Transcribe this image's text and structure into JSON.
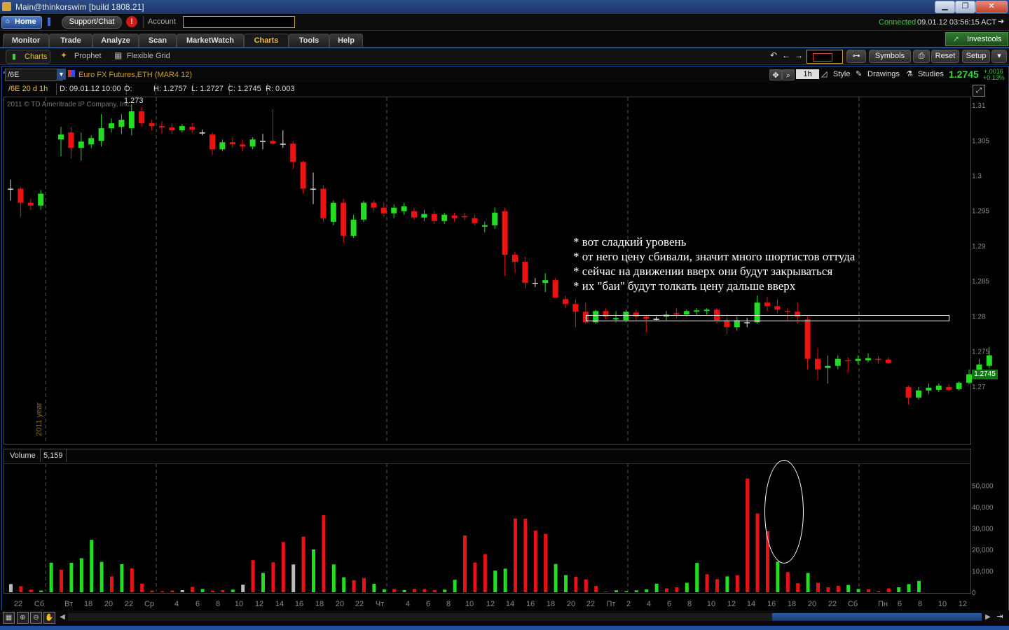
{
  "window": {
    "title": "Main@thinkorswim [build 1808.21]",
    "minimize": "▁",
    "maximize": "❐",
    "close": "✕"
  },
  "topbar": {
    "home": "Home",
    "support": "Support/Chat",
    "alert": "!",
    "account_label": "Account",
    "account_value": "",
    "status_connected": "Connected",
    "status_time": "09.01.12 03:56:15 ACT"
  },
  "tabs": [
    "Monitor",
    "Trade",
    "Analyze",
    "Scan",
    "MarketWatch",
    "Charts",
    "Tools",
    "Help"
  ],
  "investools": "Investools",
  "subtabs": {
    "charts": "Charts",
    "prophet": "Prophet",
    "flexible_grid": "Flexible Grid"
  },
  "toolbar_right": {
    "symbols": "Symbols",
    "reset": "Reset",
    "setup": "Setup"
  },
  "chart_header": {
    "symbol": "/6E",
    "description": "Euro FX Futures,ETH (MAR4 12)",
    "aggregation": "1h",
    "style": "Style",
    "drawings": "Drawings",
    "studies": "Studies",
    "last_price": "1.2745",
    "change_abs": "+.0016",
    "change_pct": "+0.13%"
  },
  "info_bar": {
    "period": "/6E 20 d 1h",
    "date": "D: 09.01.12 10:00",
    "open": "O: 1.273",
    "high": "H: 1.2757",
    "low": "L: 1.2727",
    "close": "C: 1.2745",
    "range": "R: 0.003"
  },
  "copyright": "2011 © TD Ameritrade IP Company, Inc.",
  "year_label": "2011 year",
  "price_label": "1.2745",
  "annotation": [
    "* вот сладкий уровень",
    "* от него цену сбивали, значит много шортистов оттуда",
    "* сейчас на движении вверх они будут закрываться",
    "* их \"баи\" будут толкать цену дальше вверх"
  ],
  "volume": {
    "label": "Volume",
    "value": "5,159"
  },
  "colors": {
    "up": "#22dd22",
    "down": "#ee1111",
    "neutral": "#dddddd",
    "grid": "#555555",
    "accent": "#f0c040"
  },
  "chart_data": [
    {
      "type": "candlestick",
      "y_ticks": [
        "1.31",
        "1.305",
        "1.3",
        "1.295",
        "1.29",
        "1.285",
        "1.28",
        "1.275",
        "1.27"
      ],
      "ylim": [
        1.2663,
        1.3108
      ],
      "candles": [
        {
          "o": 1.2982,
          "h": 1.2995,
          "l": 1.2965,
          "c": 1.2982
        },
        {
          "o": 1.2982,
          "h": 1.2985,
          "l": 1.2942,
          "c": 1.2962
        },
        {
          "o": 1.2962,
          "h": 1.2968,
          "l": 1.2952,
          "c": 1.2958
        },
        {
          "o": 1.2958,
          "h": 1.298,
          "l": 1.2952,
          "c": 1.2975
        },
        null,
        {
          "o": 1.3052,
          "h": 1.307,
          "l": 1.3028,
          "c": 1.3059
        },
        {
          "o": 1.3062,
          "h": 1.307,
          "l": 1.3025,
          "c": 1.304
        },
        {
          "o": 1.304,
          "h": 1.3062,
          "l": 1.3022,
          "c": 1.3049
        },
        {
          "o": 1.3045,
          "h": 1.3058,
          "l": 1.304,
          "c": 1.3054
        },
        {
          "o": 1.305,
          "h": 1.3088,
          "l": 1.3042,
          "c": 1.3068
        },
        {
          "o": 1.3068,
          "h": 1.3082,
          "l": 1.3062,
          "c": 1.3075
        },
        {
          "o": 1.307,
          "h": 1.3088,
          "l": 1.306,
          "c": 1.308
        },
        {
          "o": 1.3068,
          "h": 1.3102,
          "l": 1.3058,
          "c": 1.3092
        },
        {
          "o": 1.3092,
          "h": 1.3098,
          "l": 1.307,
          "c": 1.3075
        },
        {
          "o": 1.3075,
          "h": 1.308,
          "l": 1.3065,
          "c": 1.3071
        },
        {
          "o": 1.3071,
          "h": 1.3078,
          "l": 1.306,
          "c": 1.3069
        },
        {
          "o": 1.3069,
          "h": 1.3075,
          "l": 1.306,
          "c": 1.3065
        },
        {
          "o": 1.3065,
          "h": 1.3074,
          "l": 1.3062,
          "c": 1.3071
        },
        {
          "o": 1.307,
          "h": 1.3075,
          "l": 1.3061,
          "c": 1.3066
        },
        {
          "o": 1.3062,
          "h": 1.3066,
          "l": 1.3058,
          "c": 1.3062
        },
        {
          "o": 1.3059,
          "h": 1.3062,
          "l": 1.303,
          "c": 1.3038
        },
        {
          "o": 1.3038,
          "h": 1.3052,
          "l": 1.3035,
          "c": 1.3048
        },
        {
          "o": 1.3048,
          "h": 1.3055,
          "l": 1.304,
          "c": 1.3045
        },
        {
          "o": 1.3045,
          "h": 1.3052,
          "l": 1.3035,
          "c": 1.3042
        },
        {
          "o": 1.3042,
          "h": 1.3055,
          "l": 1.3038,
          "c": 1.3052
        },
        {
          "o": 1.305,
          "h": 1.306,
          "l": 1.3038,
          "c": 1.305
        },
        {
          "o": 1.305,
          "h": 1.3095,
          "l": 1.3045,
          "c": 1.3046
        },
        {
          "o": 1.3046,
          "h": 1.3065,
          "l": 1.304,
          "c": 1.3046
        },
        {
          "o": 1.3046,
          "h": 1.305,
          "l": 1.301,
          "c": 1.302
        },
        {
          "o": 1.302,
          "h": 1.3022,
          "l": 1.2975,
          "c": 1.2982
        },
        {
          "o": 1.2982,
          "h": 1.3005,
          "l": 1.296,
          "c": 1.2982
        },
        {
          "o": 1.2982,
          "h": 1.2987,
          "l": 1.2935,
          "c": 1.294
        },
        {
          "o": 1.2935,
          "h": 1.2965,
          "l": 1.293,
          "c": 1.2962
        },
        {
          "o": 1.2962,
          "h": 1.2968,
          "l": 1.2905,
          "c": 1.2915
        },
        {
          "o": 1.2915,
          "h": 1.2945,
          "l": 1.2912,
          "c": 1.2938
        },
        {
          "o": 1.2938,
          "h": 1.2965,
          "l": 1.2935,
          "c": 1.2962
        },
        {
          "o": 1.2962,
          "h": 1.2965,
          "l": 1.295,
          "c": 1.2955
        },
        {
          "o": 1.2955,
          "h": 1.2962,
          "l": 1.2942,
          "c": 1.2947
        },
        {
          "o": 1.2947,
          "h": 1.296,
          "l": 1.294,
          "c": 1.2955
        },
        {
          "o": 1.295,
          "h": 1.2962,
          "l": 1.2945,
          "c": 1.2957
        },
        {
          "o": 1.295,
          "h": 1.2955,
          "l": 1.2938,
          "c": 1.2941
        },
        {
          "o": 1.2941,
          "h": 1.2952,
          "l": 1.2936,
          "c": 1.2946
        },
        {
          "o": 1.2946,
          "h": 1.295,
          "l": 1.2932,
          "c": 1.2936
        },
        {
          "o": 1.2936,
          "h": 1.2948,
          "l": 1.2932,
          "c": 1.2945
        },
        {
          "o": 1.2944,
          "h": 1.2948,
          "l": 1.2935,
          "c": 1.294
        },
        {
          "o": 1.2943,
          "h": 1.2948,
          "l": 1.2937,
          "c": 1.2942
        },
        {
          "o": 1.294,
          "h": 1.2945,
          "l": 1.293,
          "c": 1.2933
        },
        {
          "o": 1.2928,
          "h": 1.2935,
          "l": 1.292,
          "c": 1.293
        },
        {
          "o": 1.293,
          "h": 1.2955,
          "l": 1.2925,
          "c": 1.2948
        },
        {
          "o": 1.295,
          "h": 1.2955,
          "l": 1.2858,
          "c": 1.2888
        },
        {
          "o": 1.2888,
          "h": 1.2892,
          "l": 1.2862,
          "c": 1.2878
        },
        {
          "o": 1.2878,
          "h": 1.2885,
          "l": 1.284,
          "c": 1.2848
        },
        {
          "o": 1.2848,
          "h": 1.2855,
          "l": 1.2842,
          "c": 1.2848
        },
        {
          "o": 1.2848,
          "h": 1.2862,
          "l": 1.2835,
          "c": 1.2852
        },
        {
          "o": 1.2852,
          "h": 1.2855,
          "l": 1.283,
          "c": 1.2827
        },
        {
          "o": 1.2825,
          "h": 1.283,
          "l": 1.2812,
          "c": 1.2818
        },
        {
          "o": 1.2818,
          "h": 1.2825,
          "l": 1.2785,
          "c": 1.2807
        },
        {
          "o": 1.2807,
          "h": 1.282,
          "l": 1.279,
          "c": 1.2792
        },
        {
          "o": 1.2792,
          "h": 1.281,
          "l": 1.279,
          "c": 1.2808
        },
        {
          "o": 1.2808,
          "h": 1.2812,
          "l": 1.2796,
          "c": 1.28
        },
        {
          "o": 1.2796,
          "h": 1.2808,
          "l": 1.2792,
          "c": 1.2798
        },
        {
          "o": 1.2795,
          "h": 1.281,
          "l": 1.2792,
          "c": 1.2807
        },
        {
          "o": 1.2806,
          "h": 1.281,
          "l": 1.2795,
          "c": 1.28
        },
        {
          "o": 1.28,
          "h": 1.2803,
          "l": 1.2778,
          "c": 1.2797
        },
        {
          "o": 1.2797,
          "h": 1.28,
          "l": 1.2795,
          "c": 1.2797
        },
        {
          "o": 1.28,
          "h": 1.2808,
          "l": 1.2795,
          "c": 1.2803
        },
        {
          "o": 1.2805,
          "h": 1.2812,
          "l": 1.2798,
          "c": 1.2803
        },
        {
          "o": 1.2803,
          "h": 1.281,
          "l": 1.28,
          "c": 1.2808
        },
        {
          "o": 1.2807,
          "h": 1.2812,
          "l": 1.2802,
          "c": 1.2809
        },
        {
          "o": 1.2808,
          "h": 1.2812,
          "l": 1.2803,
          "c": 1.281
        },
        {
          "o": 1.281,
          "h": 1.2812,
          "l": 1.279,
          "c": 1.2795
        },
        {
          "o": 1.2795,
          "h": 1.28,
          "l": 1.2775,
          "c": 1.2785
        },
        {
          "o": 1.2785,
          "h": 1.28,
          "l": 1.278,
          "c": 1.2795
        },
        {
          "o": 1.2792,
          "h": 1.2798,
          "l": 1.2785,
          "c": 1.2792
        },
        {
          "o": 1.2792,
          "h": 1.283,
          "l": 1.279,
          "c": 1.282
        },
        {
          "o": 1.282,
          "h": 1.2828,
          "l": 1.2808,
          "c": 1.2815
        },
        {
          "o": 1.2815,
          "h": 1.2825,
          "l": 1.2805,
          "c": 1.281
        },
        {
          "o": 1.2808,
          "h": 1.2812,
          "l": 1.2795,
          "c": 1.2807
        },
        {
          "o": 1.2807,
          "h": 1.282,
          "l": 1.279,
          "c": 1.28
        },
        {
          "o": 1.2796,
          "h": 1.28,
          "l": 1.2725,
          "c": 1.274
        },
        {
          "o": 1.274,
          "h": 1.2755,
          "l": 1.271,
          "c": 1.2725
        },
        {
          "o": 1.2727,
          "h": 1.2745,
          "l": 1.2705,
          "c": 1.273
        },
        {
          "o": 1.273,
          "h": 1.2745,
          "l": 1.2725,
          "c": 1.274
        },
        {
          "o": 1.2738,
          "h": 1.2742,
          "l": 1.272,
          "c": 1.2737
        },
        {
          "o": 1.2737,
          "h": 1.2745,
          "l": 1.2732,
          "c": 1.274
        },
        {
          "o": 1.2738,
          "h": 1.2748,
          "l": 1.2735,
          "c": 1.2741
        },
        {
          "o": 1.274,
          "h": 1.2744,
          "l": 1.2733,
          "c": 1.2739
        },
        {
          "o": 1.2739,
          "h": 1.2742,
          "l": 1.2733,
          "c": 1.2734
        },
        null,
        {
          "o": 1.27,
          "h": 1.2702,
          "l": 1.2675,
          "c": 1.2685
        },
        {
          "o": 1.2685,
          "h": 1.27,
          "l": 1.2682,
          "c": 1.2695
        },
        {
          "o": 1.2695,
          "h": 1.2705,
          "l": 1.269,
          "c": 1.2699
        },
        {
          "o": 1.2696,
          "h": 1.2705,
          "l": 1.2693,
          "c": 1.2702
        },
        {
          "o": 1.27,
          "h": 1.2704,
          "l": 1.2695,
          "c": 1.2696
        },
        {
          "o": 1.2697,
          "h": 1.2708,
          "l": 1.2695,
          "c": 1.2706
        },
        {
          "o": 1.2706,
          "h": 1.2725,
          "l": 1.2704,
          "c": 1.2718
        },
        {
          "o": 1.2718,
          "h": 1.274,
          "l": 1.2715,
          "c": 1.2732
        },
        {
          "o": 1.273,
          "h": 1.2757,
          "l": 1.2727,
          "c": 1.2745
        }
      ]
    },
    {
      "type": "bar",
      "ylim": [
        0,
        57000
      ],
      "y_ticks": [
        "50,000",
        "40,000",
        "30,000",
        "20,000",
        "10,000",
        "0"
      ],
      "x_ticks": [
        "22",
        "Сб",
        "Вт",
        "18",
        "20",
        "22",
        "Ср",
        "4",
        "6",
        "8",
        "10",
        "12",
        "14",
        "16",
        "18",
        "20",
        "22",
        "Чт",
        "4",
        "6",
        "8",
        "10",
        "12",
        "14",
        "16",
        "18",
        "20",
        "22",
        "Пт",
        "2",
        "4",
        "6",
        "8",
        "10",
        "12",
        "14",
        "16",
        "18",
        "20",
        "22",
        "Сб",
        "Пн",
        "6",
        "8",
        "10",
        "12"
      ],
      "bars": [
        {
          "v": 3800,
          "c": "n"
        },
        {
          "v": 2800,
          "c": "d"
        },
        {
          "v": 1200,
          "c": "d"
        },
        {
          "v": 800,
          "c": "u"
        },
        {
          "v": 13800,
          "c": "u"
        },
        {
          "v": 10500,
          "c": "d"
        },
        {
          "v": 13800,
          "c": "u"
        },
        {
          "v": 15900,
          "c": "u"
        },
        {
          "v": 24500,
          "c": "u"
        },
        {
          "v": 14200,
          "c": "u"
        },
        {
          "v": 7400,
          "c": "d"
        },
        {
          "v": 13100,
          "c": "u"
        },
        {
          "v": 11100,
          "c": "d"
        },
        {
          "v": 4000,
          "c": "d"
        },
        {
          "v": 800,
          "c": "d"
        },
        {
          "v": 500,
          "c": "d"
        },
        {
          "v": 800,
          "c": "d"
        },
        {
          "v": 1000,
          "c": "n"
        },
        {
          "v": 2500,
          "c": "d"
        },
        {
          "v": 1500,
          "c": "u"
        },
        {
          "v": 800,
          "c": "d"
        },
        {
          "v": 1000,
          "c": "d"
        },
        {
          "v": 1200,
          "c": "u"
        },
        {
          "v": 3500,
          "c": "n"
        },
        {
          "v": 15000,
          "c": "d"
        },
        {
          "v": 9000,
          "c": "u"
        },
        {
          "v": 14000,
          "c": "d"
        },
        {
          "v": 23500,
          "c": "d"
        },
        {
          "v": 13000,
          "c": "n"
        },
        {
          "v": 26000,
          "c": "d"
        },
        {
          "v": 20000,
          "c": "u"
        },
        {
          "v": 36000,
          "c": "d"
        },
        {
          "v": 13000,
          "c": "u"
        },
        {
          "v": 7000,
          "c": "u"
        },
        {
          "v": 5600,
          "c": "d"
        },
        {
          "v": 6600,
          "c": "d"
        },
        {
          "v": 3900,
          "c": "u"
        },
        {
          "v": 1300,
          "c": "u"
        },
        {
          "v": 1500,
          "c": "d"
        },
        {
          "v": 1000,
          "c": "u"
        },
        {
          "v": 1500,
          "c": "d"
        },
        {
          "v": 1500,
          "c": "d"
        },
        {
          "v": 1000,
          "c": "d"
        },
        {
          "v": 1200,
          "c": "u"
        },
        {
          "v": 5800,
          "c": "u"
        },
        {
          "v": 26500,
          "c": "d"
        },
        {
          "v": 13900,
          "c": "d"
        },
        {
          "v": 17800,
          "c": "d"
        },
        {
          "v": 10100,
          "c": "u"
        },
        {
          "v": 11000,
          "c": "u"
        },
        {
          "v": 34500,
          "c": "d"
        },
        {
          "v": 34400,
          "c": "d"
        },
        {
          "v": 28800,
          "c": "d"
        },
        {
          "v": 27300,
          "c": "d"
        },
        {
          "v": 13200,
          "c": "u"
        },
        {
          "v": 8000,
          "c": "u"
        },
        {
          "v": 7200,
          "c": "d"
        },
        {
          "v": 6000,
          "c": "d"
        },
        {
          "v": 2900,
          "c": "d"
        },
        {
          "v": 300,
          "c": "d"
        },
        {
          "v": 900,
          "c": "u"
        },
        {
          "v": 500,
          "c": "u"
        },
        {
          "v": 900,
          "c": "u"
        },
        {
          "v": 1300,
          "c": "u"
        },
        {
          "v": 4000,
          "c": "u"
        },
        {
          "v": 1800,
          "c": "d"
        },
        {
          "v": 2300,
          "c": "d"
        },
        {
          "v": 4400,
          "c": "u"
        },
        {
          "v": 13700,
          "c": "u"
        },
        {
          "v": 8400,
          "c": "d"
        },
        {
          "v": 6100,
          "c": "d"
        },
        {
          "v": 7400,
          "c": "u"
        },
        {
          "v": 7900,
          "c": "d"
        },
        {
          "v": 53200,
          "c": "d"
        },
        {
          "v": 36800,
          "c": "d"
        },
        {
          "v": 28500,
          "c": "d"
        },
        {
          "v": 14300,
          "c": "u"
        },
        {
          "v": 9400,
          "c": "d"
        },
        {
          "v": 4200,
          "c": "d"
        },
        {
          "v": 9000,
          "c": "u"
        },
        {
          "v": 4400,
          "c": "d"
        },
        {
          "v": 2300,
          "c": "d"
        },
        {
          "v": 3000,
          "c": "d"
        },
        {
          "v": 3400,
          "c": "u"
        },
        {
          "v": 1500,
          "c": "u"
        },
        {
          "v": 1300,
          "c": "d"
        },
        {
          "v": 500,
          "c": "d"
        },
        {
          "v": 1800,
          "c": "d"
        },
        {
          "v": 2300,
          "c": "u"
        },
        {
          "v": 3800,
          "c": "u"
        },
        {
          "v": 5300,
          "c": "u"
        }
      ]
    }
  ]
}
